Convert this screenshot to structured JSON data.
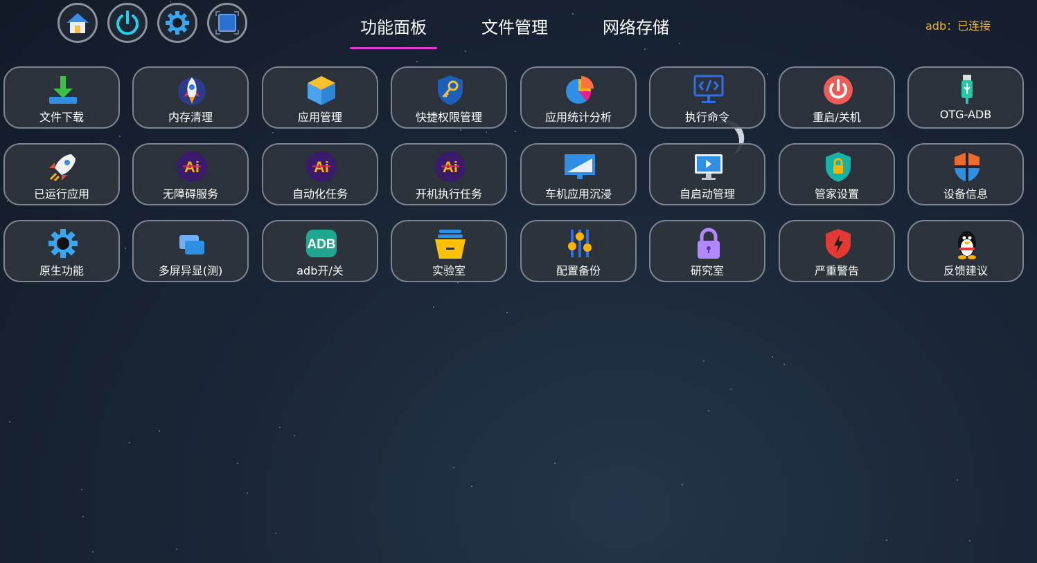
{
  "top_icons": [
    {
      "name": "home-button",
      "icon": "home-icon"
    },
    {
      "name": "power-button",
      "icon": "power-icon"
    },
    {
      "name": "settings-button",
      "icon": "gear-icon"
    },
    {
      "name": "screen-button",
      "icon": "screen-icon"
    }
  ],
  "tabs": [
    {
      "label": "功能面板",
      "active": true
    },
    {
      "label": "文件管理",
      "active": false
    },
    {
      "label": "网络存储",
      "active": false
    }
  ],
  "status": {
    "text": "adb：已连接",
    "color": "#f3b51f"
  },
  "accent": "#e33ad6",
  "tiles": [
    {
      "label": "文件下载",
      "icon": "download-icon"
    },
    {
      "label": "内存清理",
      "icon": "rocket-clean-icon"
    },
    {
      "label": "应用管理",
      "icon": "box-icon"
    },
    {
      "label": "快捷权限管理",
      "icon": "shield-key-icon"
    },
    {
      "label": "应用统计分析",
      "icon": "pie-chart-icon"
    },
    {
      "label": "执行命令",
      "icon": "code-monitor-icon"
    },
    {
      "label": "重启/关机",
      "icon": "power-red-icon"
    },
    {
      "label": "OTG-ADB",
      "icon": "usb-icon"
    },
    {
      "label": "已运行应用",
      "icon": "rocket-icon"
    },
    {
      "label": "无障碍服务",
      "icon": "ai-icon"
    },
    {
      "label": "自动化任务",
      "icon": "ai-icon"
    },
    {
      "label": "开机执行任务",
      "icon": "ai-icon"
    },
    {
      "label": "车机应用沉浸",
      "icon": "display-icon"
    },
    {
      "label": "自启动管理",
      "icon": "monitor-play-icon"
    },
    {
      "label": "管家设置",
      "icon": "shield-lock-icon"
    },
    {
      "label": "设备信息",
      "icon": "windows-shield-icon"
    },
    {
      "label": "原生功能",
      "icon": "gear-blue-icon"
    },
    {
      "label": "多屏异显(测)",
      "icon": "multi-screen-icon"
    },
    {
      "label": "adb开/关",
      "icon": "adb-icon",
      "badge": "ADB"
    },
    {
      "label": "实验室",
      "icon": "drawer-icon"
    },
    {
      "label": "配置备份",
      "icon": "sliders-icon"
    },
    {
      "label": "研究室",
      "icon": "lock-icon"
    },
    {
      "label": "严重警告",
      "icon": "alert-shield-icon"
    },
    {
      "label": "反馈建议",
      "icon": "penguin-icon"
    }
  ]
}
